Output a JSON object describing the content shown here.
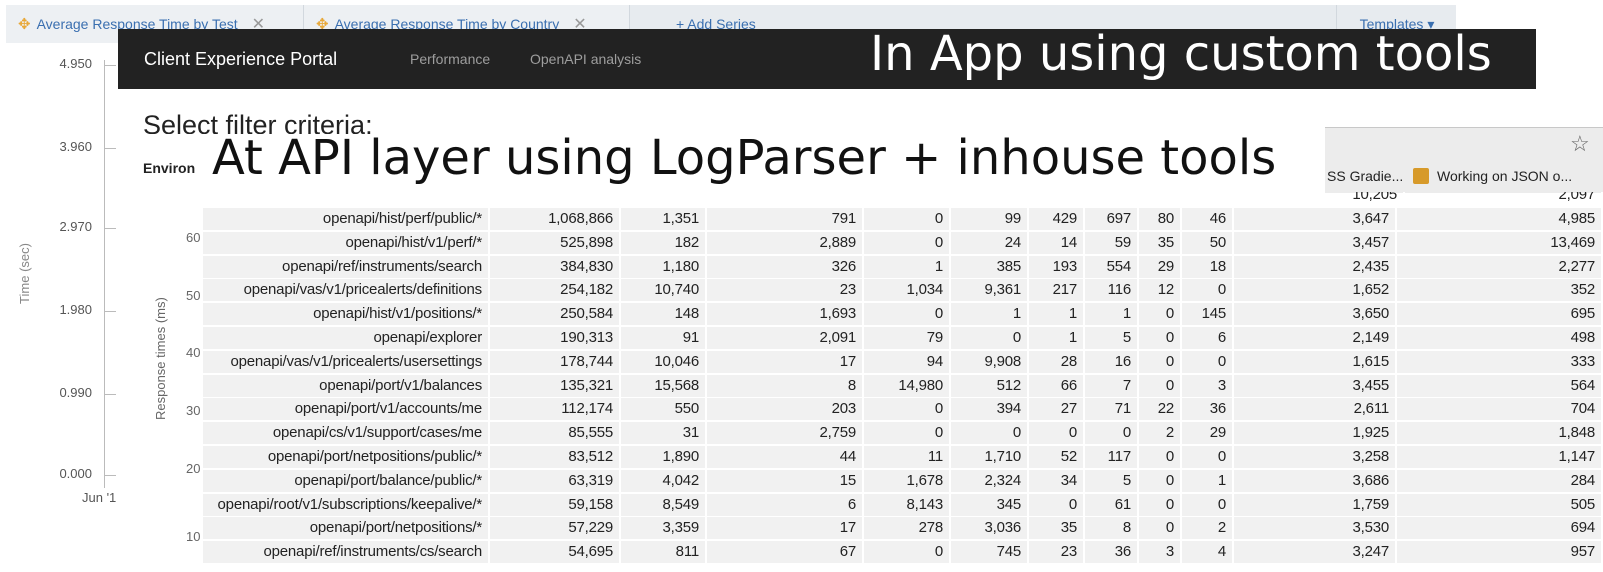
{
  "tabs": [
    {
      "label": "Average Response Time by Test",
      "icon": "gear-icon"
    },
    {
      "label": "Average Response Time by Country",
      "icon": "gear-icon"
    }
  ],
  "add_series_label": "+ Add Series",
  "templates_label": "Templates ▾",
  "chart": {
    "ytick_labels": [
      "4.950",
      "3.960",
      "2.970",
      "1.980",
      "0.990",
      "0.000"
    ],
    "ylabel": "Time (sec)",
    "xtick_first": "Jun '1"
  },
  "portal": {
    "brand": "Client Experience Portal",
    "nav": [
      "Performance",
      "OpenAPI analysis"
    ]
  },
  "overlay_app": "In App using custom tools",
  "overlay_api": "At API layer using LogParser + inhouse tools",
  "select_heading": "Select filter criteria:",
  "env_label": "Environ",
  "bookmarks": [
    "SS Gradie...",
    "Working on JSON o..."
  ],
  "response_axis": {
    "label": "Response times (ms)",
    "ticks": [
      "60",
      "50",
      "40",
      "30",
      "20",
      "10"
    ]
  },
  "api_rows": [
    [
      "openapi/hist/perf/public/*",
      "1,068,866",
      "1,351",
      "791",
      "0",
      "99",
      "429",
      "697",
      "80",
      "46",
      "3,647",
      "4,985"
    ],
    [
      "openapi/hist/v1/perf/*",
      "525,898",
      "182",
      "2,889",
      "0",
      "24",
      "14",
      "59",
      "35",
      "50",
      "3,457",
      "13,469"
    ],
    [
      "openapi/ref/instruments/search",
      "384,830",
      "1,180",
      "326",
      "1",
      "385",
      "193",
      "554",
      "29",
      "18",
      "2,435",
      "2,277"
    ],
    [
      "openapi/vas/v1/pricealerts/definitions",
      "254,182",
      "10,740",
      "23",
      "1,034",
      "9,361",
      "217",
      "116",
      "12",
      "0",
      "1,652",
      "352"
    ],
    [
      "openapi/hist/v1/positions/*",
      "250,584",
      "148",
      "1,693",
      "0",
      "1",
      "1",
      "1",
      "0",
      "145",
      "3,650",
      "695"
    ],
    [
      "openapi/explorer",
      "190,313",
      "91",
      "2,091",
      "79",
      "0",
      "1",
      "5",
      "0",
      "6",
      "2,149",
      "498"
    ],
    [
      "openapi/vas/v1/pricealerts/usersettings",
      "178,744",
      "10,046",
      "17",
      "94",
      "9,908",
      "28",
      "16",
      "0",
      "0",
      "1,615",
      "333"
    ],
    [
      "openapi/port/v1/balances",
      "135,321",
      "15,568",
      "8",
      "14,980",
      "512",
      "66",
      "7",
      "0",
      "3",
      "3,455",
      "564"
    ],
    [
      "openapi/port/v1/accounts/me",
      "112,174",
      "550",
      "203",
      "0",
      "394",
      "27",
      "71",
      "22",
      "36",
      "2,611",
      "704"
    ],
    [
      "openapi/cs/v1/support/cases/me",
      "85,555",
      "31",
      "2,759",
      "0",
      "0",
      "0",
      "0",
      "2",
      "29",
      "1,925",
      "1,848"
    ],
    [
      "openapi/port/netpositions/public/*",
      "83,512",
      "1,890",
      "44",
      "11",
      "1,710",
      "52",
      "117",
      "0",
      "0",
      "3,258",
      "1,147"
    ],
    [
      "openapi/port/balance/public/*",
      "63,319",
      "4,042",
      "15",
      "1,678",
      "2,324",
      "34",
      "5",
      "0",
      "1",
      "3,686",
      "284"
    ],
    [
      "openapi/root/v1/subscriptions/keepalive/*",
      "59,158",
      "8,549",
      "6",
      "8,143",
      "345",
      "0",
      "61",
      "0",
      "0",
      "1,759",
      "505"
    ],
    [
      "openapi/port/netpositions/*",
      "57,229",
      "3,359",
      "17",
      "278",
      "3,036",
      "35",
      "8",
      "0",
      "2",
      "3,530",
      "694"
    ],
    [
      "openapi/ref/instruments/cs/search",
      "54,695",
      "811",
      "67",
      "0",
      "745",
      "23",
      "36",
      "3",
      "4",
      "3,247",
      "957"
    ]
  ],
  "partial_top_row": [
    "10,205",
    "2,097"
  ]
}
